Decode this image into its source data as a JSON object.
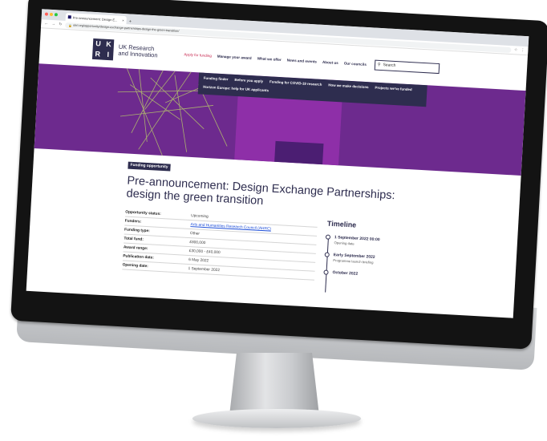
{
  "browser": {
    "tab_title": "Pre-announcement: Design E...",
    "tab_close": "×",
    "new_tab": "+",
    "url": "ukri.org/opportunity/design-exchange-partnerships-design-the-green-transition/",
    "traffic_colors": [
      "#ff5f57",
      "#febc2e",
      "#28c840"
    ]
  },
  "header": {
    "logo_letters": [
      "U",
      "K",
      "R",
      "I"
    ],
    "brand_line1": "UK Research",
    "brand_line2": "and Innovation",
    "nav": [
      {
        "label": "Apply for funding",
        "active": true
      },
      {
        "label": "Manage your award"
      },
      {
        "label": "What we offer"
      },
      {
        "label": "News and events"
      },
      {
        "label": "About us"
      },
      {
        "label": "Our councils"
      }
    ],
    "search_placeholder": "Search"
  },
  "subnav": [
    "Funding finder",
    "Before you apply",
    "Funding for COVID-19 research",
    "How we make decisions",
    "Projects we've funded",
    "Horizon Europe: help for UK applicants"
  ],
  "page": {
    "badge": "Funding opportunity",
    "title": "Pre-announcement: Design Exchange Partnerships: design the green transition"
  },
  "details": [
    {
      "label": "Opportunity status:",
      "value": "Upcoming"
    },
    {
      "label": "Funders:",
      "value": "Arts and Humanities Research Council (AHRC)",
      "link": true
    },
    {
      "label": "Funding type:",
      "value": "Other"
    },
    {
      "label": "Total fund:",
      "value": "£800,000"
    },
    {
      "label": "Award range:",
      "value": "£30,000 - £40,000"
    },
    {
      "label": "Publication date:",
      "value": "6 May 2022"
    },
    {
      "label": "Opening date:",
      "value": "1 September 2022"
    }
  ],
  "timeline": {
    "heading": "Timeline",
    "items": [
      {
        "date": "1 September 2022 00:00",
        "desc": "Opening date"
      },
      {
        "date": "Early September 2022",
        "desc": "Programme launch briefing"
      },
      {
        "date": "October 2022",
        "desc": ""
      }
    ]
  },
  "colors": {
    "brand_navy": "#2e2d4f",
    "hero_purple": "#6d2a8e",
    "active_nav": "#c7254e"
  }
}
